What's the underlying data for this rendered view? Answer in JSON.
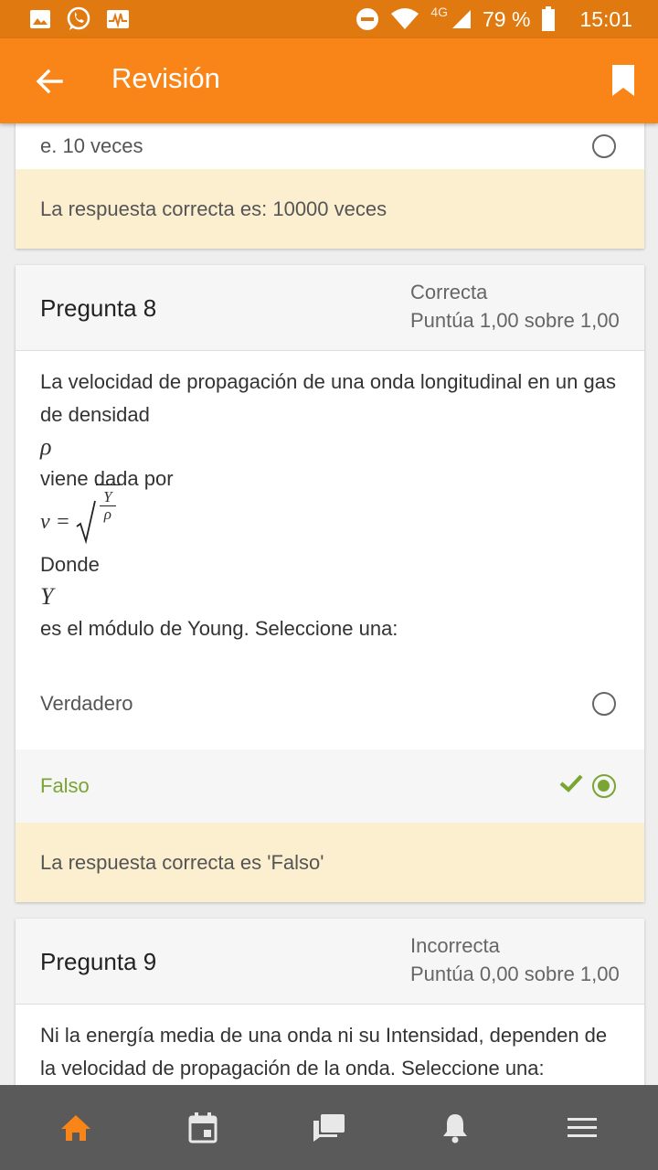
{
  "statusbar": {
    "network": "4G",
    "battery": "79 %",
    "time": "15:01"
  },
  "appbar": {
    "title": "Revisión"
  },
  "prev_question": {
    "option_label": "e. 10 veces",
    "feedback": "La respuesta correcta es: 10000 veces"
  },
  "question8": {
    "title": "Pregunta 8",
    "state": "Correcta",
    "grade": "Puntúa 1,00 sobre 1,00",
    "text_1": "La velocidad de propagación de una onda longitudinal en un gas de densidad",
    "symbol_rho": "ρ",
    "text_2": "viene dada por",
    "formula_lhs": "v =",
    "formula_num": "Y",
    "formula_den": "ρ",
    "text_3": "Donde",
    "symbol_y": "Y",
    "text_4": "es el módulo de Young. Seleccione una:",
    "options": [
      {
        "label": "Verdadero",
        "selected": false
      },
      {
        "label": "Falso",
        "selected": true,
        "correct": true
      }
    ],
    "feedback": "La respuesta correcta es 'Falso'"
  },
  "question9": {
    "title": "Pregunta 9",
    "state": "Incorrecta",
    "grade": "Puntúa 0,00 sobre 1,00",
    "text": "Ni la energía media de una onda ni su Intensidad, dependen de la velocidad de propagación de la onda. Seleccione una:"
  },
  "bottomnav": [
    "home-icon",
    "calendar-icon",
    "messages-icon",
    "notifications-icon",
    "menu-icon"
  ],
  "colors": {
    "statusbar": "#e0790f",
    "appbar": "#f98519",
    "correct_green": "#7aa433",
    "feedback_bg": "#fcefd0",
    "nav_bg": "#5a5a5a",
    "nav_active": "#f98519"
  }
}
